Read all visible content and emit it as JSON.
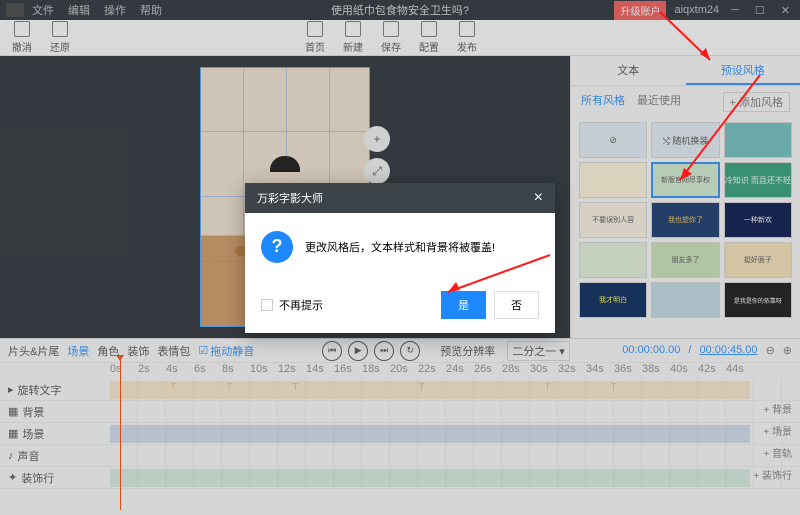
{
  "menubar": {
    "items": [
      "文件",
      "编辑",
      "操作",
      "帮助"
    ],
    "title": "使用纸巾包食物安全卫生吗?",
    "upgrade": "升级账户",
    "user": "aiqxtm24"
  },
  "toolbar": {
    "undo": "撤消",
    "redo": "还原",
    "home": "首页",
    "new": "新建",
    "save": "保存",
    "config": "配置",
    "publish": "发布"
  },
  "aspect": "16:9",
  "side": {
    "tabs": [
      "文本",
      "预设风格"
    ],
    "sub": [
      "所有风格",
      "最近使用"
    ],
    "add": "+ 添加风格",
    "cards": [
      "⊘",
      "⤭\n随机换装",
      "",
      "",
      "新版官网尽享权",
      "冷知识\n而且还不轻",
      "不要误别人容",
      "我也想你了",
      "一种新欢",
      "",
      "朋友多了",
      "挺好面子",
      "我才明白",
      "",
      "",
      "是我是你的依靠呀"
    ]
  },
  "tlnav": {
    "items": [
      "片头&片尾",
      "场景",
      "角色",
      "装饰",
      "表情包",
      "拖动静音"
    ],
    "preview": "预览分辨率",
    "zoom": "二分之一 ▾",
    "t1": "00:00:00.00",
    "t2": "00:00:45.00"
  },
  "ruler": [
    "0s",
    "2s",
    "4s",
    "6s",
    "8s",
    "10s",
    "12s",
    "14s",
    "16s",
    "18s",
    "20s",
    "22s",
    "24s",
    "26s",
    "28s",
    "30s",
    "32s",
    "34s",
    "36s",
    "38s",
    "40s",
    "42s",
    "44s"
  ],
  "tracks": {
    "rotate": "旋转文字",
    "bg": "背景",
    "scene": "场景",
    "audio": "声音",
    "decor": "装饰行",
    "add_bg": "+ 背景",
    "add_scene": "+ 场景",
    "add_audio": "+ 音轨",
    "add_decor": "+ 装饰行"
  },
  "modal": {
    "title": "万彩字影大师",
    "msg": "更改风格后，文本样式和背景将被覆盖!",
    "dont": "不再提示",
    "yes": "是",
    "no": "否"
  }
}
